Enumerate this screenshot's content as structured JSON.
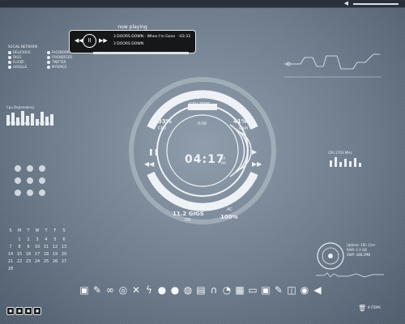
{
  "topbar": {
    "volume_icon": "speaker-icon"
  },
  "now_playing": {
    "title": "now playing",
    "track_line_1": "3 DOORS DOWN - When I'm Gone",
    "track_line_2": "3 DOORS DOWN",
    "time": "-03:33"
  },
  "social": {
    "header": "SOCIAL NETWORK",
    "items": [
      "DELICIOUS",
      "DIGG",
      "FLICKR",
      "GOOGLE",
      "FACEBOOK",
      "FRIENDFEED",
      "TWITTER",
      "MYSPACE"
    ]
  },
  "cpu_panel": {
    "title": "Cpu  Dependency",
    "freq": "CPU 2703 MHz",
    "load": "10% 67%"
  },
  "hud": {
    "temp": "0 C",
    "temp_label": "CPU TEMP",
    "cpu_pct": "33%",
    "cpu_label": "CPU",
    "ram_pct": "41%",
    "ram_label": "RAM",
    "time": "04:17",
    "seconds": "44",
    "meridiem": "PM",
    "hd_size": "11.2 GIGS",
    "hd_label": "HD",
    "ac_pct": "100%",
    "ac_label": "AC",
    "small_top": "0:00"
  },
  "calendar": {
    "headers": [
      "S",
      "M",
      "T",
      "W",
      "T",
      "F",
      "S"
    ],
    "rows": [
      [
        "",
        "1",
        "2",
        "3",
        "4",
        "5",
        "6"
      ],
      [
        "7",
        "8",
        "9",
        "10",
        "11",
        "12",
        "13"
      ],
      [
        "14",
        "15",
        "16",
        "17",
        "18",
        "19",
        "20"
      ],
      [
        "21",
        "22",
        "23",
        "24",
        "25",
        "26",
        "27"
      ],
      [
        "28",
        "",
        "",
        "",
        "",
        "",
        ""
      ]
    ]
  },
  "right_system": {
    "label": "CPU 2703 MHz",
    "temp": "0 C"
  },
  "resource_meter": {
    "line1": "Uptime: 16h 11m",
    "line2": "RAM: 1.0 GB",
    "line3": "SWP: 488.2MB"
  },
  "dock": {
    "icons": [
      "computer-icon",
      "wrench-icon",
      "link-icon",
      "search-icon",
      "close-icon",
      "lightning-icon",
      "power-icon",
      "firefox-icon",
      "disc-icon",
      "camera-icon",
      "magnet-icon",
      "chat-icon",
      "image-icon",
      "gamepad-icon",
      "photos-icon",
      "pencil-icon",
      "bag-icon",
      "disc-2-icon",
      "speaker-icon"
    ]
  },
  "trash": {
    "label": "8 ITEMS"
  }
}
